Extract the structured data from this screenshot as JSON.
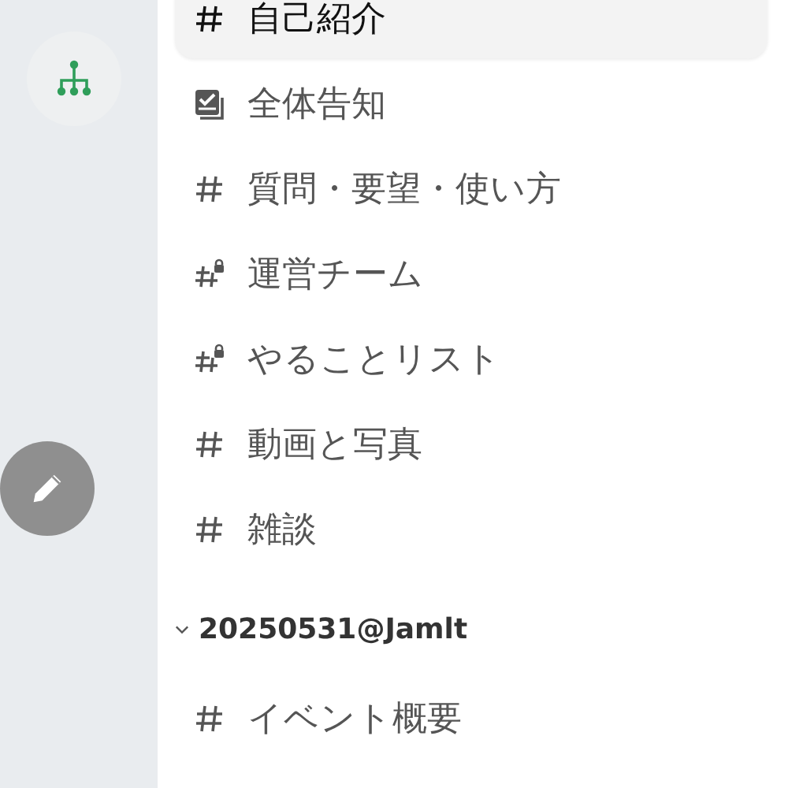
{
  "channels": [
    {
      "kind": "hash",
      "name": "自己紹介",
      "selected": true
    },
    {
      "kind": "announce",
      "name": "全体告知",
      "selected": false
    },
    {
      "kind": "hash",
      "name": "質問・要望・使い方",
      "selected": false
    },
    {
      "kind": "private",
      "name": "運営チーム",
      "selected": false
    },
    {
      "kind": "private",
      "name": "やることリスト",
      "selected": false
    },
    {
      "kind": "hash",
      "name": "動画と写真",
      "selected": false
    },
    {
      "kind": "hash",
      "name": "雑談",
      "selected": false
    }
  ],
  "section": {
    "title": "20250531@Jamlt",
    "expanded": true,
    "channels": [
      {
        "kind": "hash",
        "name": "イベント概要",
        "selected": false
      }
    ]
  }
}
